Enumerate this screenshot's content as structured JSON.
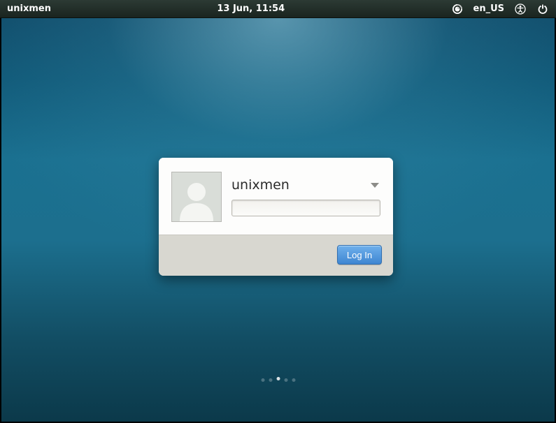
{
  "panel": {
    "hostname": "unixmen",
    "datetime": "13 Jun, 11:54",
    "language": "en_US"
  },
  "login": {
    "username": "unixmen",
    "password_value": "",
    "button_label": "Log In"
  }
}
